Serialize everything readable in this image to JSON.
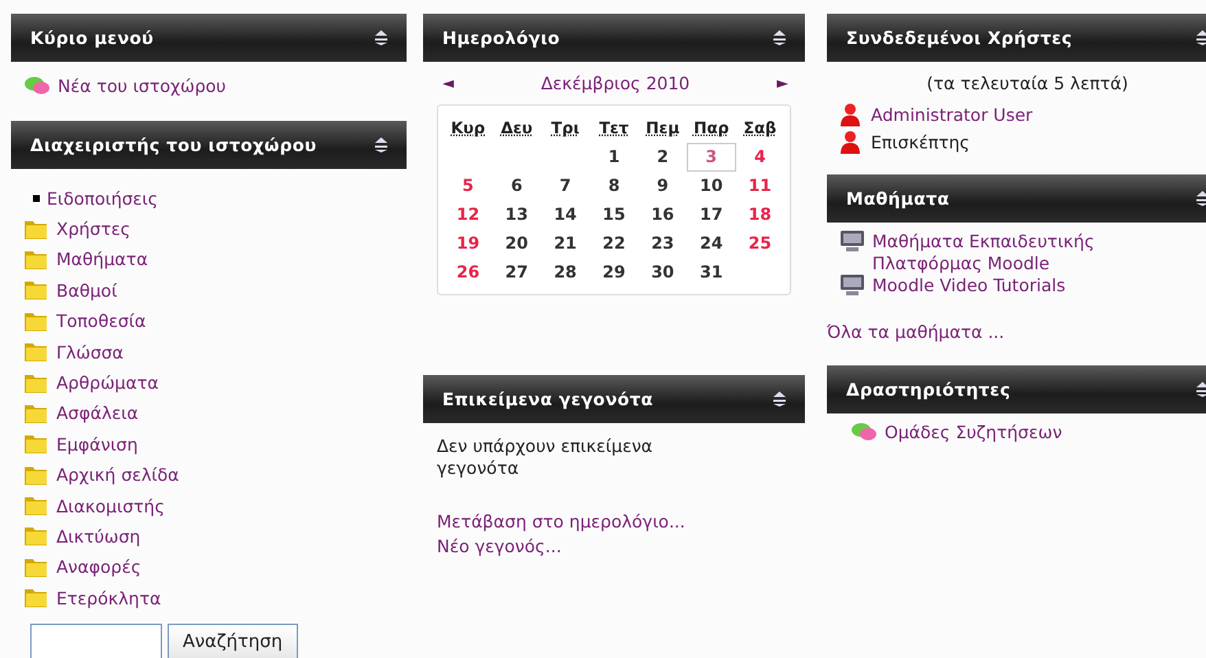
{
  "main_menu": {
    "title": "Κύριο μενού",
    "items": [
      {
        "label": "Νέα του ιστοχώρου"
      }
    ]
  },
  "site_admin": {
    "title": "Διαχειριστής του ιστοχώρου",
    "items": [
      {
        "kind": "bullet",
        "label": "Ειδοποιήσεις"
      },
      {
        "kind": "folder",
        "label": "Χρήστες"
      },
      {
        "kind": "folder",
        "label": "Μαθήματα"
      },
      {
        "kind": "folder",
        "label": "Βαθμοί"
      },
      {
        "kind": "folder",
        "label": "Τοποθεσία"
      },
      {
        "kind": "folder",
        "label": "Γλώσσα"
      },
      {
        "kind": "folder",
        "label": "Αρθρώματα"
      },
      {
        "kind": "folder",
        "label": "Ασφάλεια"
      },
      {
        "kind": "folder",
        "label": "Εμφάνιση"
      },
      {
        "kind": "folder",
        "label": "Αρχική σελίδα"
      },
      {
        "kind": "folder",
        "label": "Διακομιστής"
      },
      {
        "kind": "folder",
        "label": "Δικτύωση"
      },
      {
        "kind": "folder",
        "label": "Αναφορές"
      },
      {
        "kind": "folder",
        "label": "Ετερόκλητα"
      }
    ],
    "search_button": "Αναζήτηση"
  },
  "calendar": {
    "title": "Ημερολόγιο",
    "prev": "◄",
    "month": "Δεκέμβριος 2010",
    "next": "►",
    "weekdays": [
      "Κυρ",
      "Δευ",
      "Τρι",
      "Τετ",
      "Πεμ",
      "Παρ",
      "Σαβ"
    ],
    "weeks": [
      {
        "kind": "leading",
        "days": [
          {
            "day": "1",
            "weekend": false,
            "today": false
          },
          {
            "day": "2",
            "weekend": false,
            "today": false
          },
          {
            "day": "3",
            "weekend": false,
            "today": true
          },
          {
            "day": "4",
            "weekend": true,
            "today": false
          }
        ]
      },
      {
        "kind": "full",
        "days": [
          {
            "day": "5",
            "weekend": true,
            "today": false
          },
          {
            "day": "6",
            "weekend": false,
            "today": false
          },
          {
            "day": "7",
            "weekend": false,
            "today": false
          },
          {
            "day": "8",
            "weekend": false,
            "today": false
          },
          {
            "day": "9",
            "weekend": false,
            "today": false
          },
          {
            "day": "10",
            "weekend": false,
            "today": false
          },
          {
            "day": "11",
            "weekend": true,
            "today": false
          }
        ]
      },
      {
        "kind": "full",
        "days": [
          {
            "day": "12",
            "weekend": true,
            "today": false
          },
          {
            "day": "13",
            "weekend": false,
            "today": false
          },
          {
            "day": "14",
            "weekend": false,
            "today": false
          },
          {
            "day": "15",
            "weekend": false,
            "today": false
          },
          {
            "day": "16",
            "weekend": false,
            "today": false
          },
          {
            "day": "17",
            "weekend": false,
            "today": false
          },
          {
            "day": "18",
            "weekend": true,
            "today": false
          }
        ]
      },
      {
        "kind": "full",
        "days": [
          {
            "day": "19",
            "weekend": true,
            "today": false
          },
          {
            "day": "20",
            "weekend": false,
            "today": false
          },
          {
            "day": "21",
            "weekend": false,
            "today": false
          },
          {
            "day": "22",
            "weekend": false,
            "today": false
          },
          {
            "day": "23",
            "weekend": false,
            "today": false
          },
          {
            "day": "24",
            "weekend": false,
            "today": false
          },
          {
            "day": "25",
            "weekend": true,
            "today": false
          }
        ]
      },
      {
        "kind": "trailing",
        "days": [
          {
            "day": "26",
            "weekend": true,
            "today": false
          },
          {
            "day": "27",
            "weekend": false,
            "today": false
          },
          {
            "day": "28",
            "weekend": false,
            "today": false
          },
          {
            "day": "29",
            "weekend": false,
            "today": false
          },
          {
            "day": "30",
            "weekend": false,
            "today": false
          },
          {
            "day": "31",
            "weekend": false,
            "today": false
          }
        ]
      }
    ]
  },
  "upcoming_events": {
    "title": "Επικείμενα γεγονότα",
    "message": "Δεν υπάρχουν επικείμενα γεγονότα",
    "links": [
      "Μετάβαση στο ημερολόγιο...",
      "Νέο γεγονός..."
    ]
  },
  "online_users": {
    "title": "Συνδεδεμένοι Χρήστες",
    "note": "(τα τελευταία 5 λεπτά)",
    "users": [
      {
        "name": "Administrator User",
        "linked": true
      },
      {
        "name": "Επισκέπτης",
        "linked": false
      }
    ]
  },
  "courses": {
    "title": "Μαθήματα",
    "items": [
      "Μαθήματα Εκπαιδευτικής Πλατφόρμας Moodle",
      "Moodle Video Tutorials"
    ],
    "all_link": "Όλα τα μαθήματα ..."
  },
  "activities": {
    "title": "Δραστηριότητες",
    "items": [
      "Ομάδες Συζητήσεων"
    ]
  }
}
